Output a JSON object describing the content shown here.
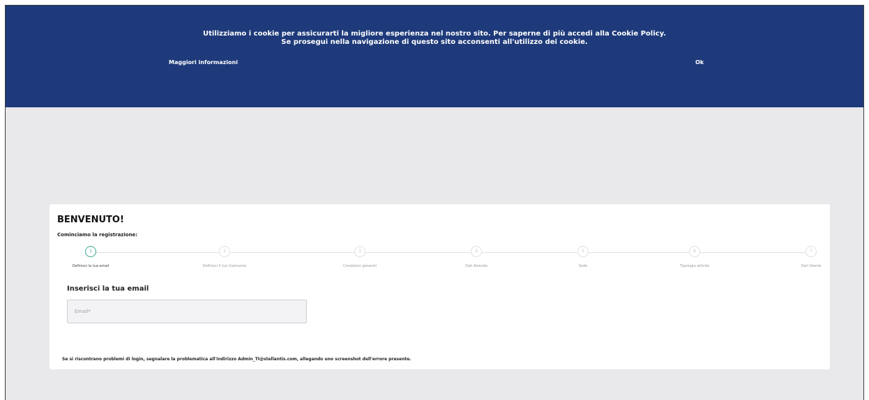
{
  "cookie_banner": {
    "line1": "Utilizziamo i cookie per assicurarti la migliore esperienza nel nostro sito. Per saperne di più accedi alla Cookie Policy.",
    "line2": "Se prosegui nella navigazione di questo sito acconsenti all'utilizzo dei cookie.",
    "more_info_label": "Maggiori informazioni",
    "ok_label": "Ok",
    "background_color": "#1e3a7b"
  },
  "registration": {
    "title": "BENVENUTO!",
    "subtitle": "Cominciamo la registrazione:",
    "active_step_color": "#3aa88f",
    "steps": [
      {
        "number": "1",
        "label": "Definisci la tua email",
        "active": true
      },
      {
        "number": "2",
        "label": "Definisci il tuo Username",
        "active": false
      },
      {
        "number": "3",
        "label": "Condizioni generali",
        "active": false
      },
      {
        "number": "4",
        "label": "Dati Azienda",
        "active": false
      },
      {
        "number": "5",
        "label": "Sede",
        "active": false
      },
      {
        "number": "6",
        "label": "Tipologia attività",
        "active": false
      },
      {
        "number": "7",
        "label": "Dati Utente",
        "active": false
      }
    ],
    "email_heading": "Inserisci la tua email",
    "email_placeholder": "Email*",
    "email_value": "",
    "footer_note": "Se si riscontrano problemi di login, segnalare la problematica all'indirizzo Admin_TI@stellantis.com, allegando uno screenshot dell'errore presente."
  }
}
